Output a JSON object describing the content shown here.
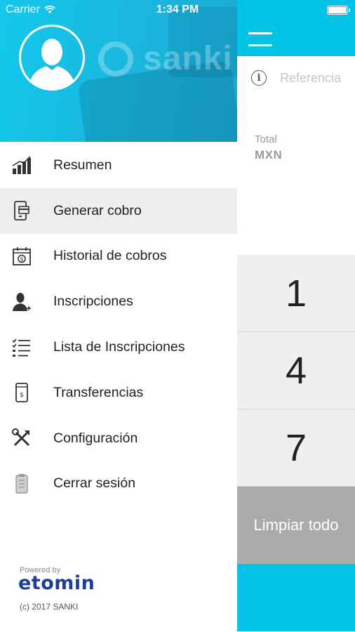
{
  "status_bar": {
    "carrier": "Carrier",
    "time": "1:34 PM"
  },
  "drawer": {
    "brand_watermark": "sanki",
    "menu": [
      {
        "label": "Resumen",
        "icon": "bar-chart-icon",
        "active": false
      },
      {
        "label": "Generar cobro",
        "icon": "payment-terminal-icon",
        "active": true
      },
      {
        "label": "Historial de cobros",
        "icon": "calendar-money-icon",
        "active": false
      },
      {
        "label": "Inscripciones",
        "icon": "user-add-icon",
        "active": false
      },
      {
        "label": "Lista de Inscripciones",
        "icon": "checklist-icon",
        "active": false
      },
      {
        "label": "Transferencias",
        "icon": "phone-transfer-icon",
        "active": false
      },
      {
        "label": "Configuración",
        "icon": "tools-icon",
        "active": false
      },
      {
        "label": "Cerrar sesión",
        "icon": "logout-icon",
        "active": false
      }
    ],
    "footer": {
      "powered_by": "Powered by",
      "brand": "etomin",
      "copyright": "(c) 2017 SANKI"
    }
  },
  "main": {
    "reference_placeholder": "Referencia",
    "total_label": "Total",
    "currency": "MXN",
    "keypad": [
      "1",
      "4",
      "7"
    ],
    "clear_label": "Limpiar todo"
  },
  "colors": {
    "accent": "#00c3e6",
    "active_row": "#eeeeee",
    "brand_blue": "#1f3c96",
    "clear_key": "#ababab"
  }
}
